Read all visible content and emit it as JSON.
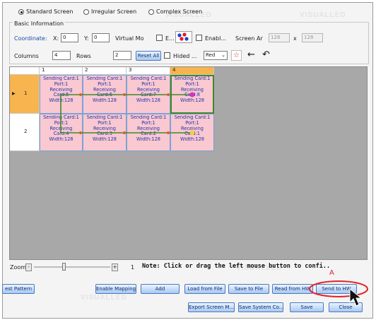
{
  "screen_types": {
    "standard": "Standard Screen",
    "irregular": "Irregular Screen",
    "complex": "Complex Screen",
    "selected": "standard"
  },
  "basic_info": {
    "title": "Basic Information",
    "coordinate_label": "Coordinate:",
    "x_label": "X:",
    "x_value": "0",
    "y_label": "Y:",
    "y_value": "0",
    "virtual_mode_label": "Virtual Mo",
    "e_label": "E...",
    "enable_label": "Enabl...",
    "screen_ar_label": "Screen Ar",
    "screen_w": "128",
    "screen_sep": "x",
    "screen_h": "128",
    "columns_label": "Columns",
    "columns_value": "4",
    "rows_label": "Rows",
    "rows_value": "2",
    "reset_all": "Reset All",
    "hidden_label": "Hided ...",
    "color_select": "Red"
  },
  "grid": {
    "column_headers": [
      "1",
      "2",
      "3",
      "4"
    ],
    "row_headers": [
      "1",
      "2"
    ],
    "selected_column": "4",
    "selected_row": "1",
    "cells": [
      [
        {
          "l1": "Sending Card:1",
          "l2": "Port:1",
          "l3": "Receiving",
          "l4": "Card:5",
          "l5": "Width:128"
        },
        {
          "l1": "Sending Card:1",
          "l2": "Port:1",
          "l3": "Receiving",
          "l4": "Card:6",
          "l5": "Width:128"
        },
        {
          "l1": "Sending Card:1",
          "l2": "Port:1",
          "l3": "Receiving",
          "l4": "Card:7",
          "l5": "Width:128"
        },
        {
          "l1": "Sending Card:1",
          "l2": "Port:1",
          "l3": "Receiving",
          "l4": "Card:8",
          "l5": "Width:128"
        }
      ],
      [
        {
          "l1": "Sending Card:1",
          "l2": "Port:1",
          "l3": "Receiving",
          "l4": "Card:4",
          "l5": "Width:128"
        },
        {
          "l1": "Sending Card:1",
          "l2": "Port:1",
          "l3": "Receiving",
          "l4": "Card:3",
          "l5": "Width:128"
        },
        {
          "l1": "Sending Card:1",
          "l2": "Port:1",
          "l3": "Receiving",
          "l4": "Card:2",
          "l5": "Width:128"
        },
        {
          "l1": "Sending Card:1",
          "l2": "Port:1",
          "l3": "Receiving",
          "l4": "Card:1",
          "l5": "Width:128"
        }
      ]
    ]
  },
  "zoom": {
    "label": "Zoom",
    "value": "1",
    "note": "Note: Click or drag the left mouse button to confi.."
  },
  "buttons": {
    "test_pattern": "est Pattern",
    "enable_mapping": "Enable Mapping",
    "add": "Add",
    "load_from_file": "Load from File",
    "save_to_file": "Save to File",
    "read_from_hw": "Read from HW",
    "send_to_hw": "Send to HW",
    "export_screen": "Export Screen M...",
    "save_system_co": "Save System Co...",
    "save": "Save",
    "close": "Close"
  },
  "annotation": {
    "marker": "A"
  },
  "watermark": "VISUALLED",
  "colors": {
    "highlight_red": "#e3212a",
    "cell_pink": "#f9c8d0",
    "header_orange": "#f7b44f",
    "chain_green": "#3c8a2a",
    "button_blue": "#4a78c2"
  }
}
